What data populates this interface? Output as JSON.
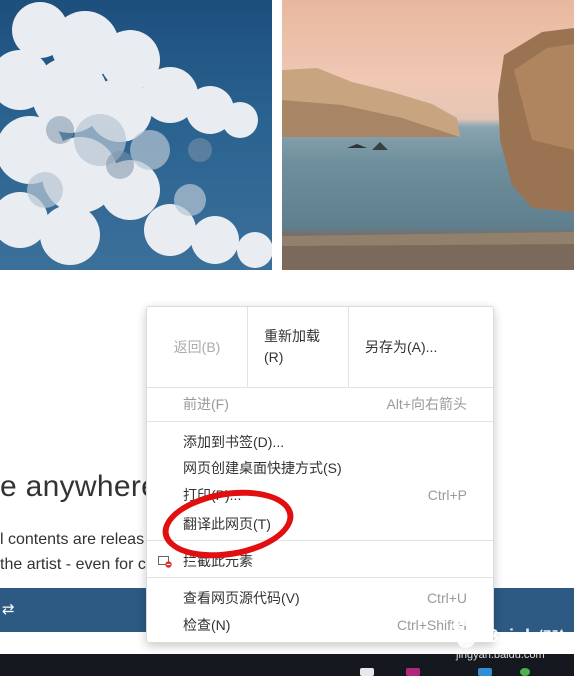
{
  "page": {
    "heading": "e anywhere",
    "line1": "l contents are releas",
    "line2": "the artist - even for c",
    "bar_glyph": "⇄"
  },
  "context_menu": {
    "top_row": [
      {
        "label": "返回(B)",
        "enabled": false
      },
      {
        "label": "重新加载(R)",
        "enabled": true
      },
      {
        "label": "另存为(A)...",
        "enabled": true
      }
    ],
    "items": [
      {
        "label": "前进(F)",
        "shortcut": "Alt+向右箭头",
        "enabled": false
      },
      {
        "label": "添加到书签(D)...",
        "shortcut": "",
        "enabled": true
      },
      {
        "label": "网页创建桌面快捷方式(S)",
        "shortcut": "",
        "enabled": true
      },
      {
        "label": "打印(P)...",
        "shortcut": "Ctrl+P",
        "enabled": true
      },
      {
        "label": "翻译此网页(T)",
        "shortcut": "",
        "enabled": true
      },
      {
        "label": "拦截此元素",
        "shortcut": "",
        "enabled": true,
        "icon": "block-element-icon"
      },
      {
        "label": "查看网页源代码(V)",
        "shortcut": "Ctrl+U",
        "enabled": true
      },
      {
        "label": "检查(N)",
        "shortcut": "Ctrl+Shift+I",
        "enabled": true
      }
    ]
  },
  "annotation": {
    "color": "#e10f0f",
    "target": "翻译此网页(T)"
  },
  "watermark": {
    "brand": "Bai du 经验",
    "url": "jingyan.baidu.com"
  }
}
